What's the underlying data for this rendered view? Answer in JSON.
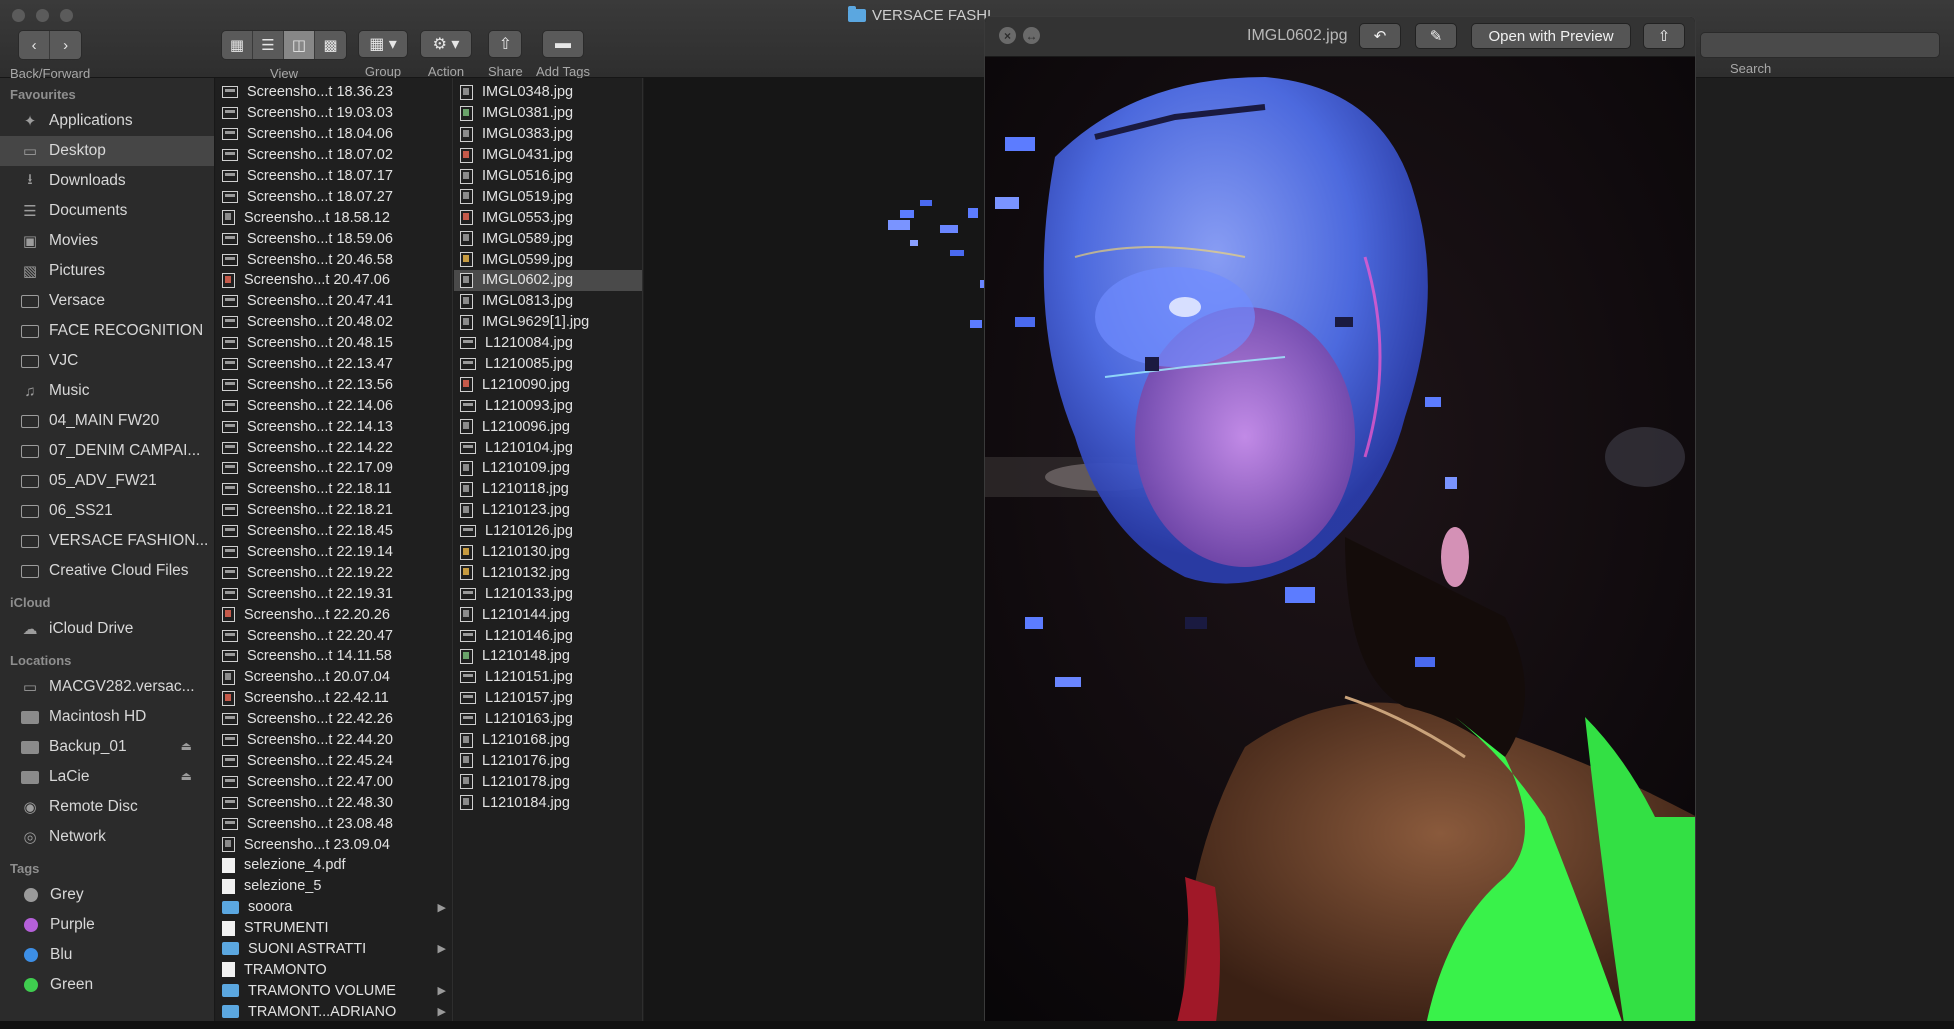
{
  "window": {
    "title": "VERSACE FASHI"
  },
  "toolbar": {
    "back_forward_label": "Back/Forward",
    "back_icon": "chevron-left-icon",
    "forward_icon": "chevron-right-icon",
    "view_label": "View",
    "group_label": "Group",
    "action_label": "Action",
    "share_label": "Share",
    "add_tags_label": "Add Tags",
    "search_label": "Search"
  },
  "sidebar": {
    "favourites_title": "Favourites",
    "favourites": [
      {
        "label": "Applications",
        "icon": "applications-icon"
      },
      {
        "label": "Desktop",
        "icon": "desktop-icon",
        "selected": true
      },
      {
        "label": "Downloads",
        "icon": "downloads-icon"
      },
      {
        "label": "Documents",
        "icon": "documents-icon"
      },
      {
        "label": "Movies",
        "icon": "movies-icon"
      },
      {
        "label": "Pictures",
        "icon": "pictures-icon"
      },
      {
        "label": "Versace",
        "icon": "folder-icon"
      },
      {
        "label": "FACE RECOGNITION",
        "icon": "folder-icon"
      },
      {
        "label": "VJC",
        "icon": "folder-icon"
      },
      {
        "label": "Music",
        "icon": "music-icon"
      },
      {
        "label": "04_MAIN FW20",
        "icon": "folder-icon"
      },
      {
        "label": "07_DENIM CAMPAI...",
        "icon": "folder-icon"
      },
      {
        "label": "05_ADV_FW21",
        "icon": "folder-icon"
      },
      {
        "label": "06_SS21",
        "icon": "folder-icon"
      },
      {
        "label": "VERSACE FASHION...",
        "icon": "folder-icon"
      },
      {
        "label": "Creative Cloud Files",
        "icon": "folder-icon"
      }
    ],
    "icloud_title": "iCloud",
    "icloud": [
      {
        "label": "iCloud Drive",
        "icon": "cloud-icon"
      }
    ],
    "locations_title": "Locations",
    "locations": [
      {
        "label": "MACGV282.versac...",
        "icon": "computer-icon"
      },
      {
        "label": "Macintosh HD",
        "icon": "disk-icon"
      },
      {
        "label": "Backup_01",
        "icon": "disk-icon",
        "eject": true
      },
      {
        "label": "LaCie",
        "icon": "disk-icon",
        "eject": true
      },
      {
        "label": "Remote Disc",
        "icon": "disc-icon"
      },
      {
        "label": "Network",
        "icon": "network-icon"
      }
    ],
    "tags_title": "Tags",
    "tags": [
      {
        "label": "Grey",
        "color": "#9a9a9a"
      },
      {
        "label": "Purple",
        "color": "#b560d9"
      },
      {
        "label": "Blu",
        "color": "#3d8fe6"
      },
      {
        "label": "Green",
        "color": "#3fcd4f"
      }
    ]
  },
  "column1": [
    {
      "name": "Screensho...t 18.36.23",
      "type": "land"
    },
    {
      "name": "Screensho...t 19.03.03",
      "type": "land"
    },
    {
      "name": "Screensho...t 18.04.06",
      "type": "land"
    },
    {
      "name": "Screensho...t 18.07.02",
      "type": "land"
    },
    {
      "name": "Screensho...t 18.07.17",
      "type": "land"
    },
    {
      "name": "Screensho...t 18.07.27",
      "type": "land"
    },
    {
      "name": "Screensho...t 18.58.12",
      "type": "port"
    },
    {
      "name": "Screensho...t 18.59.06",
      "type": "land"
    },
    {
      "name": "Screensho...t 20.46.58",
      "type": "land"
    },
    {
      "name": "Screensho...t 20.47.06",
      "type": "red"
    },
    {
      "name": "Screensho...t 20.47.41",
      "type": "land"
    },
    {
      "name": "Screensho...t 20.48.02",
      "type": "land"
    },
    {
      "name": "Screensho...t 20.48.15",
      "type": "land"
    },
    {
      "name": "Screensho...t 22.13.47",
      "type": "land"
    },
    {
      "name": "Screensho...t 22.13.56",
      "type": "land"
    },
    {
      "name": "Screensho...t 22.14.06",
      "type": "land"
    },
    {
      "name": "Screensho...t 22.14.13",
      "type": "land"
    },
    {
      "name": "Screensho...t 22.14.22",
      "type": "land"
    },
    {
      "name": "Screensho...t 22.17.09",
      "type": "land"
    },
    {
      "name": "Screensho...t 22.18.11",
      "type": "land"
    },
    {
      "name": "Screensho...t 22.18.21",
      "type": "land"
    },
    {
      "name": "Screensho...t 22.18.45",
      "type": "land"
    },
    {
      "name": "Screensho...t 22.19.14",
      "type": "land"
    },
    {
      "name": "Screensho...t 22.19.22",
      "type": "land"
    },
    {
      "name": "Screensho...t 22.19.31",
      "type": "land"
    },
    {
      "name": "Screensho...t 22.20.26",
      "type": "red"
    },
    {
      "name": "Screensho...t 22.20.47",
      "type": "land"
    },
    {
      "name": "Screensho...t 14.11.58",
      "type": "land"
    },
    {
      "name": "Screensho...t 20.07.04",
      "type": "port"
    },
    {
      "name": "Screensho...t 22.42.11",
      "type": "red"
    },
    {
      "name": "Screensho...t 22.42.26",
      "type": "land"
    },
    {
      "name": "Screensho...t 22.44.20",
      "type": "land"
    },
    {
      "name": "Screensho...t 22.45.24",
      "type": "land"
    },
    {
      "name": "Screensho...t 22.47.00",
      "type": "land"
    },
    {
      "name": "Screensho...t 22.48.30",
      "type": "land"
    },
    {
      "name": "Screensho...t 23.08.48",
      "type": "land"
    },
    {
      "name": "Screensho...t 23.09.04",
      "type": "port"
    },
    {
      "name": "selezione_4.pdf",
      "type": "doc"
    },
    {
      "name": "selezione_5",
      "type": "doc"
    },
    {
      "name": "sooora",
      "type": "folder",
      "arrow": true
    },
    {
      "name": "STRUMENTI",
      "type": "doc"
    },
    {
      "name": "SUONI ASTRATTI",
      "type": "folder",
      "arrow": true
    },
    {
      "name": "TRAMONTO",
      "type": "doc"
    },
    {
      "name": "TRAMONTO VOLUME",
      "type": "folder",
      "arrow": true
    },
    {
      "name": "TRAMONT...ADRIANO",
      "type": "folder",
      "arrow": true
    }
  ],
  "column2": [
    {
      "name": "IMGL0348.jpg",
      "type": "port"
    },
    {
      "name": "IMGL0381.jpg",
      "type": "green"
    },
    {
      "name": "IMGL0383.jpg",
      "type": "port"
    },
    {
      "name": "IMGL0431.jpg",
      "type": "red"
    },
    {
      "name": "IMGL0516.jpg",
      "type": "port"
    },
    {
      "name": "IMGL0519.jpg",
      "type": "port"
    },
    {
      "name": "IMGL0553.jpg",
      "type": "red"
    },
    {
      "name": "IMGL0589.jpg",
      "type": "port"
    },
    {
      "name": "IMGL0599.jpg",
      "type": "gold"
    },
    {
      "name": "IMGL0602.jpg",
      "type": "port",
      "selected": true
    },
    {
      "name": "IMGL0813.jpg",
      "type": "port"
    },
    {
      "name": "IMGL9629[1].jpg",
      "type": "port"
    },
    {
      "name": "L1210084.jpg",
      "type": "land"
    },
    {
      "name": "L1210085.jpg",
      "type": "land"
    },
    {
      "name": "L1210090.jpg",
      "type": "red"
    },
    {
      "name": "L1210093.jpg",
      "type": "land"
    },
    {
      "name": "L1210096.jpg",
      "type": "port"
    },
    {
      "name": "L1210104.jpg",
      "type": "land"
    },
    {
      "name": "L1210109.jpg",
      "type": "port"
    },
    {
      "name": "L1210118.jpg",
      "type": "port"
    },
    {
      "name": "L1210123.jpg",
      "type": "port"
    },
    {
      "name": "L1210126.jpg",
      "type": "land"
    },
    {
      "name": "L1210130.jpg",
      "type": "gold"
    },
    {
      "name": "L1210132.jpg",
      "type": "gold"
    },
    {
      "name": "L1210133.jpg",
      "type": "land"
    },
    {
      "name": "L1210144.jpg",
      "type": "port"
    },
    {
      "name": "L1210146.jpg",
      "type": "land"
    },
    {
      "name": "L1210148.jpg",
      "type": "green"
    },
    {
      "name": "L1210151.jpg",
      "type": "land"
    },
    {
      "name": "L1210157.jpg",
      "type": "land"
    },
    {
      "name": "L1210163.jpg",
      "type": "land"
    },
    {
      "name": "L1210168.jpg",
      "type": "port"
    },
    {
      "name": "L1210176.jpg",
      "type": "port"
    },
    {
      "name": "L1210178.jpg",
      "type": "port"
    },
    {
      "name": "L1210184.jpg",
      "type": "port"
    }
  ],
  "quicklook": {
    "filename": "IMGL0602.jpg",
    "open_with_label": "Open with Preview",
    "close_icon": "close-icon",
    "fullscreen_icon": "fullscreen-icon",
    "rotate_icon": "rotate-icon",
    "markup_icon": "markup-icon",
    "share_icon": "share-icon"
  },
  "colors": {
    "accent_green_dress": "#39f24a",
    "glitch_blue": "#5c7cff",
    "glitch_magenta": "#c070ff",
    "selection": "#4a4a4a"
  }
}
